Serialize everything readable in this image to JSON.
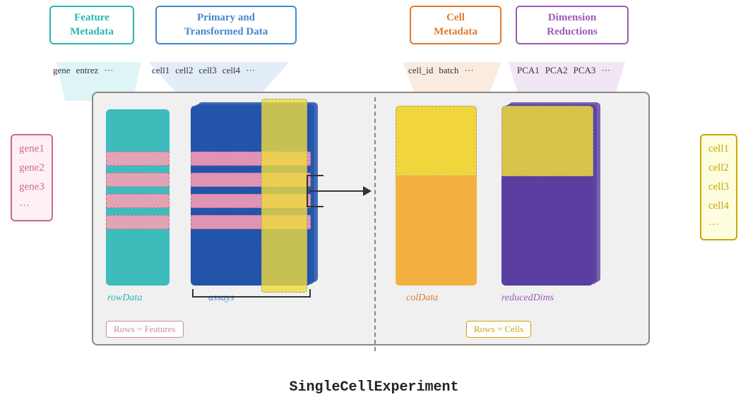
{
  "headers": {
    "feature_meta": "Feature\nMetadata",
    "primary": "Primary and\nTransformed Data",
    "cell_meta": "Cell\nMetadata",
    "dim_red": "Dimension\nReductions"
  },
  "col_headers": {
    "feature": [
      "gene",
      "entrez",
      "···"
    ],
    "primary": [
      "cell1",
      "cell2",
      "cell3",
      "cell4",
      "···"
    ],
    "cell": [
      "cell_id",
      "batch",
      "···"
    ],
    "dim": [
      "PCA1",
      "PCA2",
      "PCA3",
      "···"
    ]
  },
  "row_labels": {
    "items": [
      "gene1",
      "gene2",
      "gene3",
      "···"
    ]
  },
  "cell_labels": {
    "items": [
      "cell1",
      "cell2",
      "cell3",
      "cell4",
      "···"
    ]
  },
  "component_labels": {
    "rowdata": "rowData",
    "assays": "assays",
    "coldata": "colData",
    "reddims": "reducedDims"
  },
  "annotations": {
    "rows_features": "Rows = Features",
    "rows_cells": "Rows = Cells"
  },
  "title": "SingleCellExperiment"
}
